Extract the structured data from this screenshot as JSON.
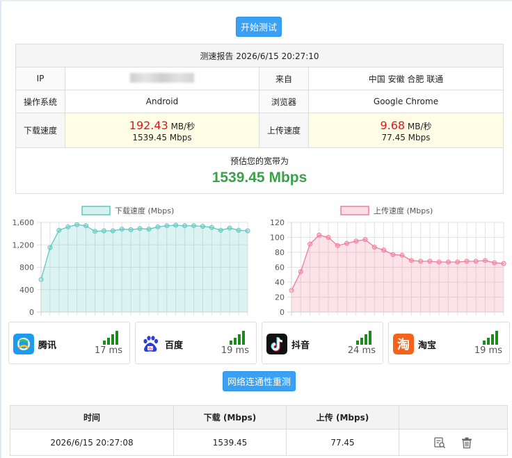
{
  "start_button": "开始测试",
  "report": {
    "title": "测速报告 2026/6/15 20:27:10",
    "ip_label": "IP",
    "from_label": "来自",
    "from_value": "中国 安徽 合肥 联通",
    "os_label": "操作系统",
    "os_value": "Android",
    "browser_label": "浏览器",
    "browser_value": "Google Chrome",
    "download_label": "下载速度",
    "download_value": "192.43",
    "download_unit": "MB/秒",
    "download_mbps": "1539.45 Mbps",
    "upload_label": "上传速度",
    "upload_value": "9.68",
    "upload_unit": "MB/秒",
    "upload_mbps": "77.45 Mbps",
    "estimate_label": "预估您的宽带为",
    "estimate_value": "1539.45 Mbps"
  },
  "chart_data": [
    {
      "type": "area",
      "legend": "下载速度 (Mbps)",
      "legend_position": "top",
      "ylim": [
        0,
        1600
      ],
      "yticks": [
        "0",
        "400",
        "800",
        "1,200",
        "1,600"
      ],
      "grid": true,
      "color": "#5cc8c0",
      "values": [
        580,
        1150,
        1460,
        1520,
        1560,
        1540,
        1440,
        1450,
        1450,
        1480,
        1470,
        1490,
        1480,
        1520,
        1540,
        1550,
        1540,
        1540,
        1530,
        1510,
        1460,
        1500,
        1460,
        1450
      ]
    },
    {
      "type": "area",
      "legend": "上传速度 (Mbps)",
      "legend_position": "top",
      "ylim": [
        0,
        120
      ],
      "yticks": [
        "0",
        "20",
        "40",
        "60",
        "80",
        "100",
        "120"
      ],
      "grid": true,
      "color": "#f37a9a",
      "values": [
        29,
        54,
        91,
        103,
        100,
        89,
        92,
        95,
        97,
        87,
        83,
        77,
        76,
        69,
        68,
        68,
        67,
        67,
        67,
        68,
        68,
        69,
        66,
        65
      ]
    }
  ],
  "services": [
    {
      "name": "腾讯",
      "latency": "17 ms",
      "logo_icon": "tencent-icon"
    },
    {
      "name": "百度",
      "latency": "19 ms",
      "logo_icon": "baidu-icon"
    },
    {
      "name": "抖音",
      "latency": "24 ms",
      "logo_icon": "douyin-icon"
    },
    {
      "name": "淘宝",
      "latency": "19 ms",
      "logo_icon": "taobao-icon"
    }
  ],
  "retest_button": "网络连通性重测",
  "results": {
    "headers": [
      "时间",
      "下载 (Mbps)",
      "上传 (Mbps)",
      ""
    ],
    "rows": [
      {
        "time": "2026/6/15 20:27:08",
        "download": "1539.45",
        "upload": "77.45"
      }
    ]
  },
  "colors": {
    "accent": "#3aa0f3",
    "download_red": "#e0151c",
    "estimate_green": "#3aa04a",
    "signal_green": "#1e8a1e"
  }
}
